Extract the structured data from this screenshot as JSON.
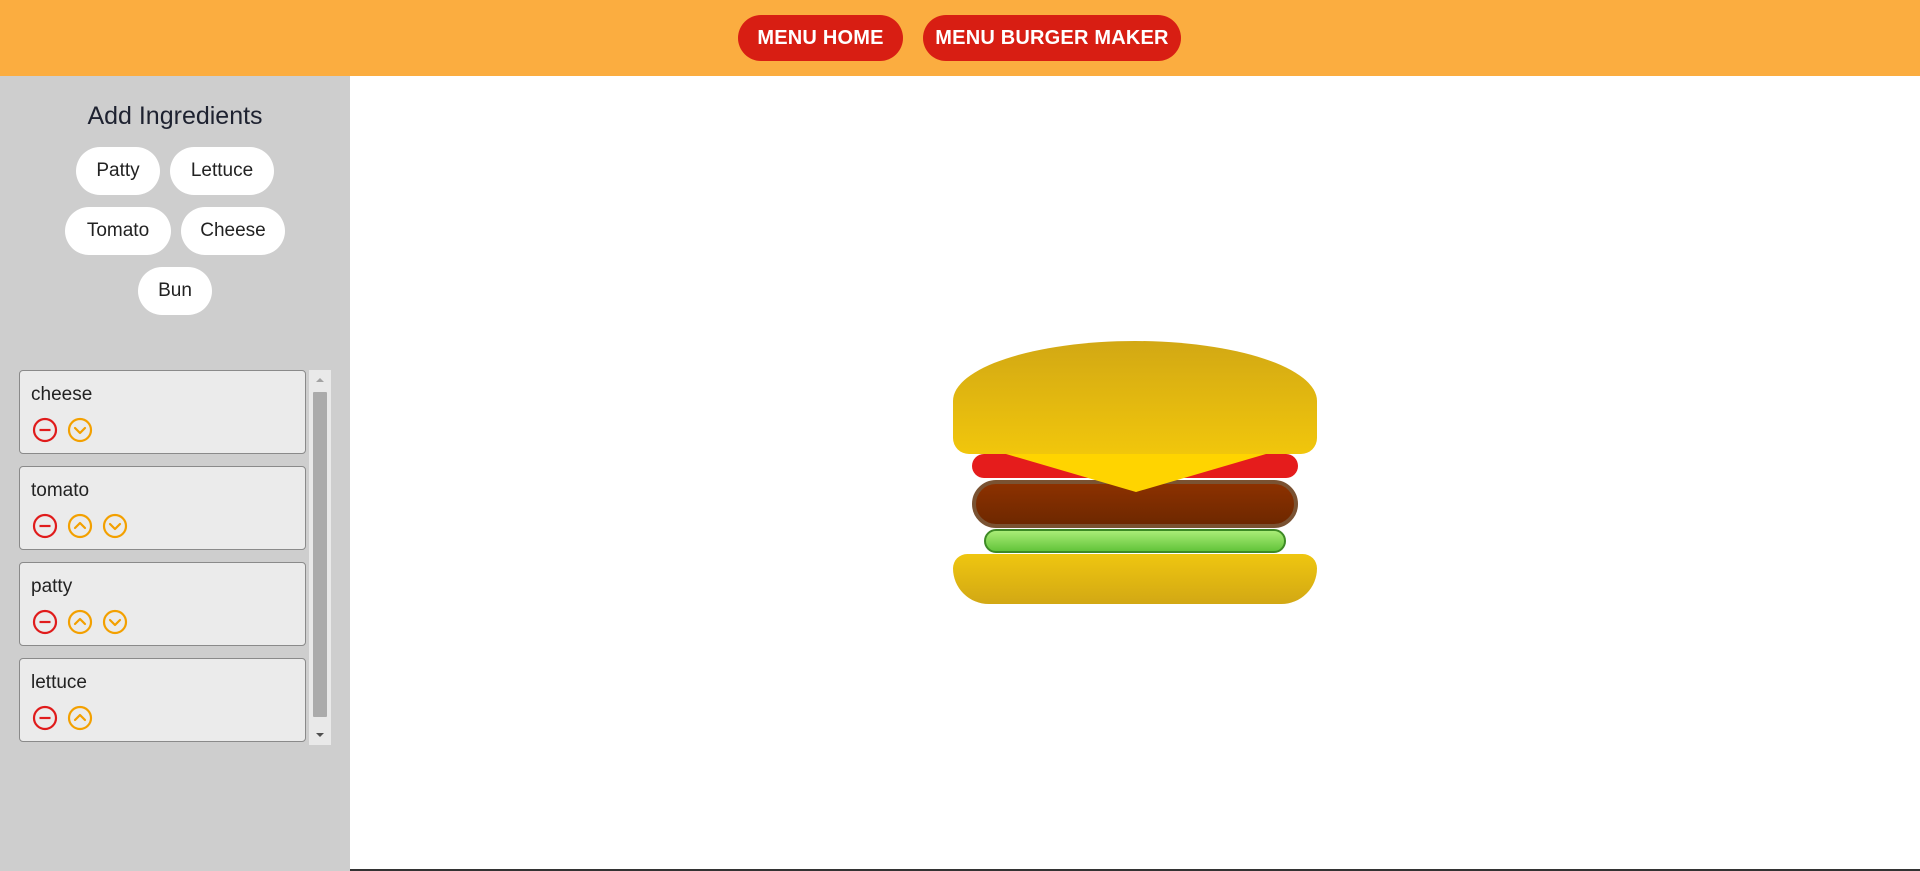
{
  "nav": {
    "home_label": "MENU HOME",
    "maker_label": "MENU BURGER MAKER"
  },
  "sidebar": {
    "title": "Add Ingredients",
    "add_buttons": [
      "Patty",
      "Lettuce",
      "Tomato",
      "Cheese",
      "Bun"
    ]
  },
  "stack_list": [
    {
      "label": "cheese",
      "controls": [
        "remove",
        "move-down"
      ]
    },
    {
      "label": "tomato",
      "controls": [
        "remove",
        "move-up",
        "move-down"
      ]
    },
    {
      "label": "patty",
      "controls": [
        "remove",
        "move-up",
        "move-down"
      ]
    },
    {
      "label": "lettuce",
      "controls": [
        "remove",
        "move-up"
      ]
    }
  ],
  "burger_preview": {
    "layers_top_to_bottom": [
      "bun",
      "cheese",
      "tomato",
      "patty",
      "lettuce",
      "bun"
    ]
  },
  "colors": {
    "header": "#fbad40",
    "nav_button": "#d81e13",
    "sidebar": "#cecece",
    "remove_icon": "#e01b1b",
    "move_icon": "#f3a000",
    "bun": "#e8bd0f",
    "tomato": "#e51c1c",
    "cheese": "#ffd400",
    "patty": "#7a2c00",
    "lettuce": "#8fdc5c"
  }
}
